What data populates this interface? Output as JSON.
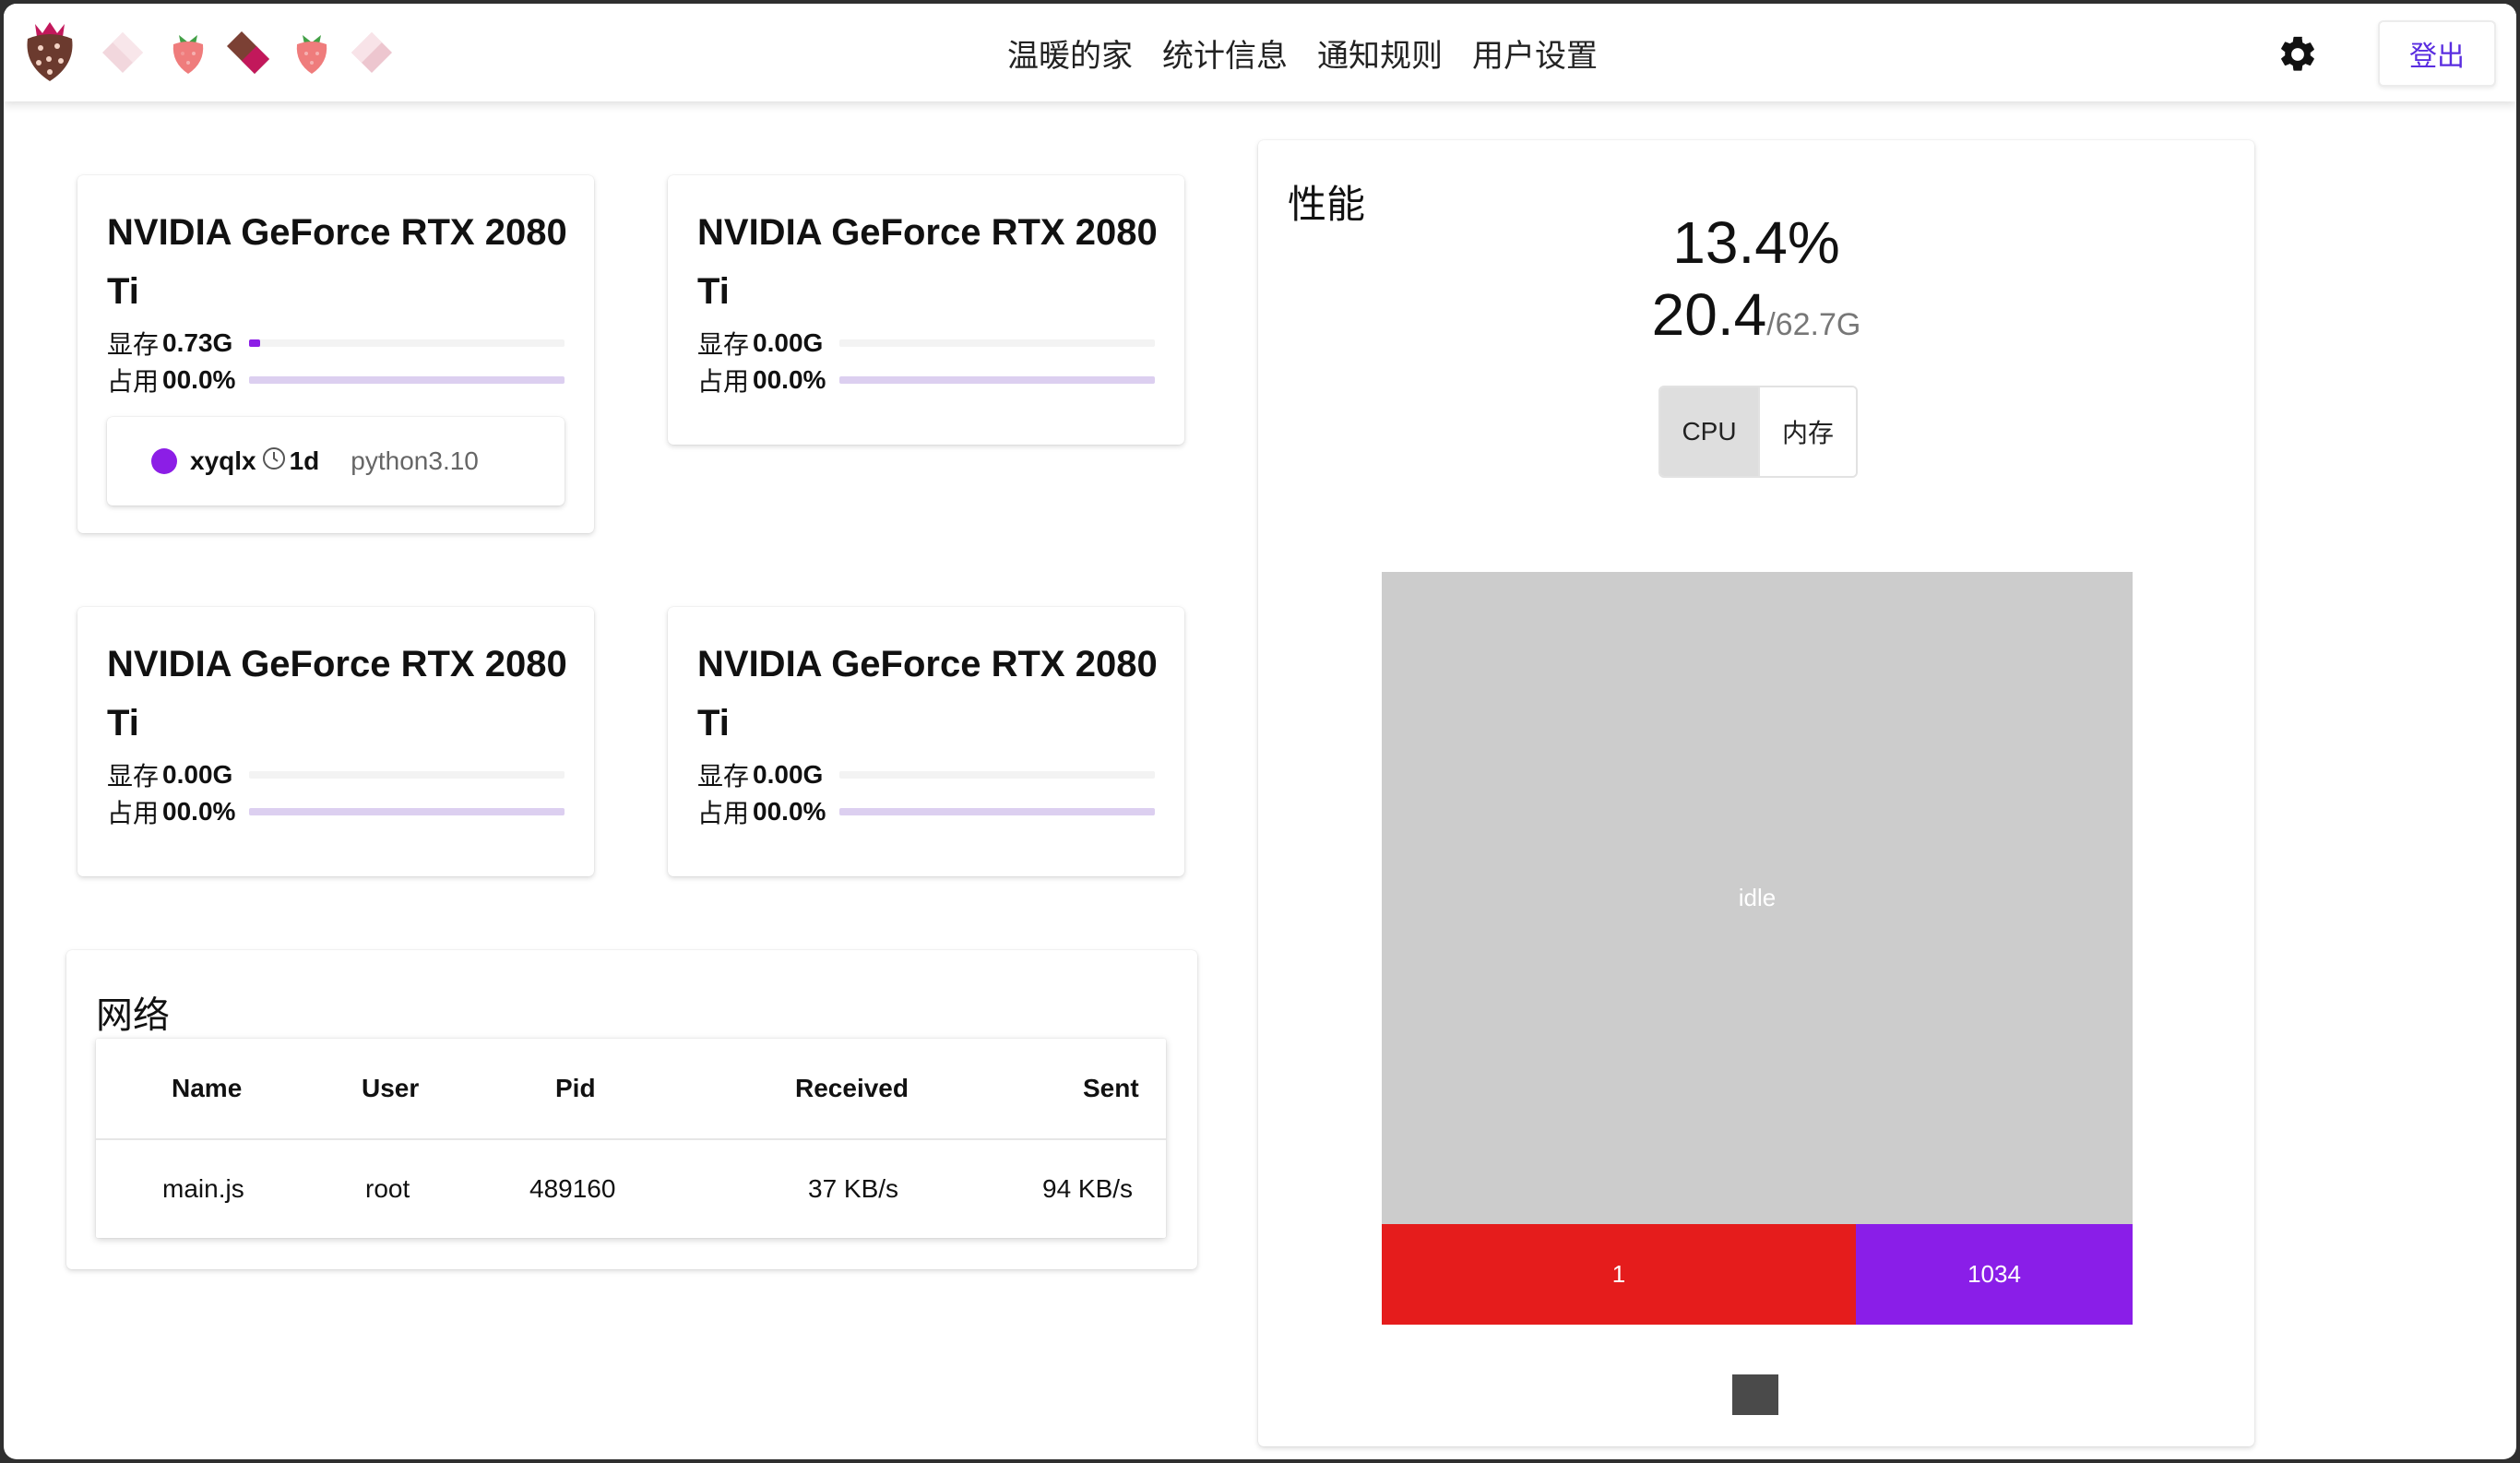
{
  "nav": {
    "links": [
      "温暖的家",
      "统计信息",
      "通知规则",
      "用户设置"
    ],
    "logout_label": "登出",
    "icons": {
      "logo": "strawberry-logo-icon",
      "decorations": [
        "pink-diamond-icon",
        "strawberry-icon",
        "chocolate-icon",
        "strawberry-icon",
        "pink-diamond-icon"
      ],
      "settings": "gear-icon"
    }
  },
  "gpus": [
    {
      "name": "NVIDIA GeForce RTX 2080 Ti",
      "mem_label": "显存",
      "mem_value": "0.73G",
      "mem_fraction": 0.035,
      "util_label": "占用",
      "util_value": "00.0%",
      "util_fraction": 0.0,
      "process": {
        "user": "xyqlx",
        "duration": "1d",
        "command": "python3.10",
        "color": "#8c1ee6"
      }
    },
    {
      "name": "NVIDIA GeForce RTX 2080 Ti",
      "mem_label": "显存",
      "mem_value": "0.00G",
      "mem_fraction": 0.0,
      "util_label": "占用",
      "util_value": "00.0%",
      "util_fraction": 0.0
    },
    {
      "name": "NVIDIA GeForce RTX 2080 Ti",
      "mem_label": "显存",
      "mem_value": "0.00G",
      "mem_fraction": 0.0,
      "util_label": "占用",
      "util_value": "00.0%",
      "util_fraction": 0.0
    },
    {
      "name": "NVIDIA GeForce RTX 2080 Ti",
      "mem_label": "显存",
      "mem_value": "0.00G",
      "mem_fraction": 0.0,
      "util_label": "占用",
      "util_value": "00.0%",
      "util_fraction": 0.0
    }
  ],
  "network": {
    "title": "网络",
    "columns": [
      "Name",
      "User",
      "Pid",
      "Received",
      "Sent"
    ],
    "rows": [
      [
        "main.js",
        "root",
        "489160",
        "37 KB/s",
        "94 KB/s"
      ]
    ]
  },
  "performance": {
    "title": "性能",
    "cpu_percent": "13.4%",
    "mem_used": "20.4",
    "mem_total": "/62.7G",
    "toggle": [
      "CPU",
      "内存"
    ],
    "active_toggle": "CPU",
    "treemap": [
      {
        "label": "idle",
        "value": 86.6,
        "color": "#cccccc"
      },
      {
        "label": "1",
        "value": 8.4,
        "color": "#e51c1c"
      },
      {
        "label": "1034",
        "value": 4.9,
        "color": "#8a1ee8"
      }
    ],
    "legend_color": "#4a4a4a"
  }
}
